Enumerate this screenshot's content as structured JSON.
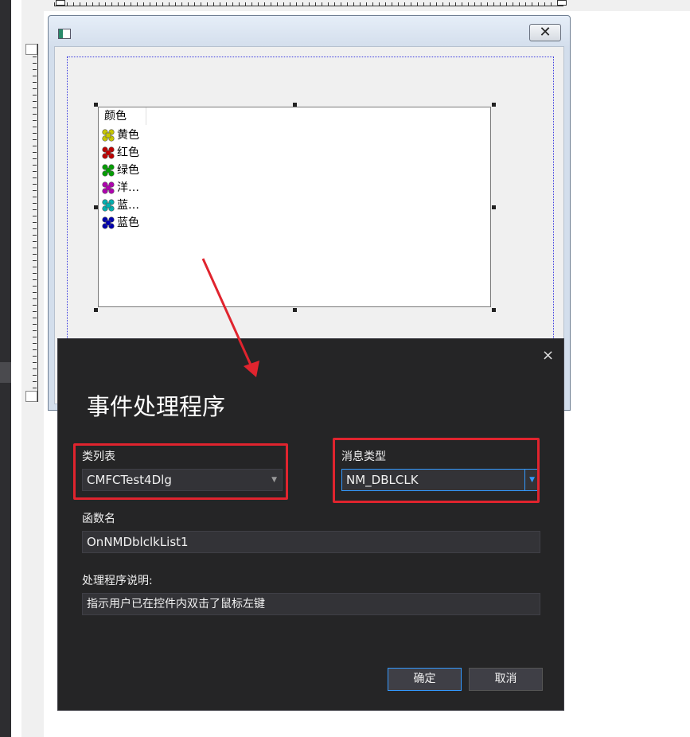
{
  "designer": {
    "list_header": "颜色",
    "list_items": [
      {
        "label": "黄色",
        "icon": "yellow-puzzle-icon",
        "color": "#c8c800"
      },
      {
        "label": "红色",
        "icon": "red-puzzle-icon",
        "color": "#c00000"
      },
      {
        "label": "绿色",
        "icon": "green-puzzle-icon",
        "color": "#00a000"
      },
      {
        "label": "洋…",
        "icon": "magenta-puzzle-icon",
        "color": "#b000b0"
      },
      {
        "label": "蓝…",
        "icon": "cyan-puzzle-icon",
        "color": "#00b0b0"
      },
      {
        "label": "蓝色",
        "icon": "blue-puzzle-icon",
        "color": "#0000b0"
      }
    ],
    "close_glyph": "✕"
  },
  "dialog": {
    "title": "事件处理程序",
    "close_glyph": "×",
    "class_list_label": "类列表",
    "class_list_value": "CMFCTest4Dlg",
    "message_type_label": "消息类型",
    "message_type_value": "NM_DBLCLK",
    "function_name_label": "函数名",
    "function_name_value": "OnNMDblclkList1",
    "description_label": "处理程序说明:",
    "description_value": "指示用户已在控件内双击了鼠标左键",
    "ok_label": "确定",
    "cancel_label": "取消"
  },
  "colors": {
    "highlight": "#e0242e",
    "focus": "#3399ff",
    "dialog_bg": "#252526"
  }
}
